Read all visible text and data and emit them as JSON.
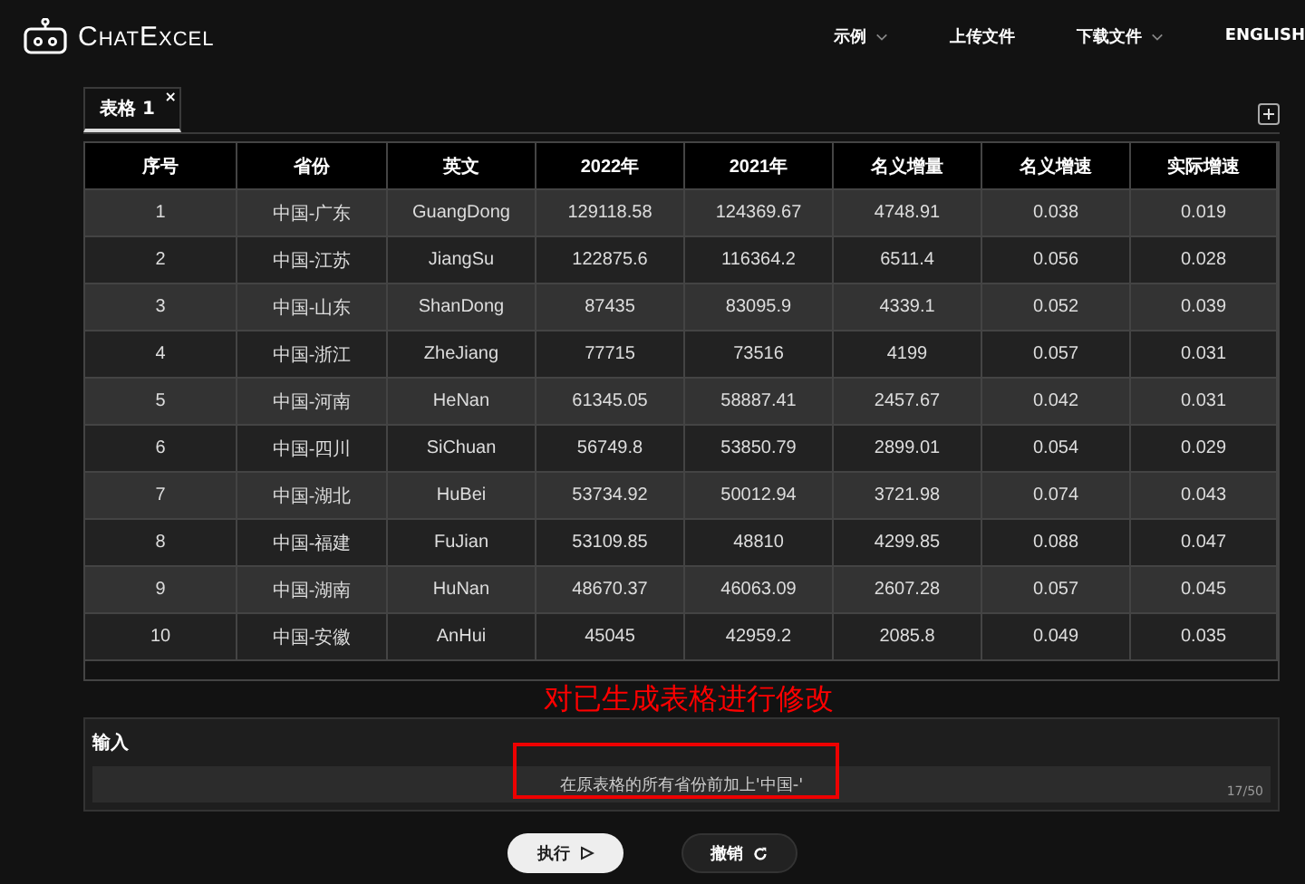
{
  "header": {
    "logo": "ChatExcel",
    "nav": [
      {
        "label": "示例",
        "dropdown": true
      },
      {
        "label": "上传文件",
        "dropdown": false
      },
      {
        "label": "下载文件",
        "dropdown": true
      },
      {
        "label": "ENGLISH",
        "dropdown": false
      }
    ]
  },
  "tabs": [
    {
      "label": "表格 1",
      "selected": true,
      "close": "×"
    }
  ],
  "table": {
    "columns": [
      "序号",
      "省份",
      "英文",
      "2022年",
      "2021年",
      "名义增量",
      "名义增速",
      "实际增速"
    ],
    "rows": [
      [
        "1",
        "中国-广东",
        "GuangDong",
        "129118.58",
        "124369.67",
        "4748.91",
        "0.038",
        "0.019"
      ],
      [
        "2",
        "中国-江苏",
        "JiangSu",
        "122875.6",
        "116364.2",
        "6511.4",
        "0.056",
        "0.028"
      ],
      [
        "3",
        "中国-山东",
        "ShanDong",
        "87435",
        "83095.9",
        "4339.1",
        "0.052",
        "0.039"
      ],
      [
        "4",
        "中国-浙江",
        "ZheJiang",
        "77715",
        "73516",
        "4199",
        "0.057",
        "0.031"
      ],
      [
        "5",
        "中国-河南",
        "HeNan",
        "61345.05",
        "58887.41",
        "2457.67",
        "0.042",
        "0.031"
      ],
      [
        "6",
        "中国-四川",
        "SiChuan",
        "56749.8",
        "53850.79",
        "2899.01",
        "0.054",
        "0.029"
      ],
      [
        "7",
        "中国-湖北",
        "HuBei",
        "53734.92",
        "50012.94",
        "3721.98",
        "0.074",
        "0.043"
      ],
      [
        "8",
        "中国-福建",
        "FuJian",
        "53109.85",
        "48810",
        "4299.85",
        "0.088",
        "0.047"
      ],
      [
        "9",
        "中国-湖南",
        "HuNan",
        "48670.37",
        "46063.09",
        "2607.28",
        "0.057",
        "0.045"
      ],
      [
        "10",
        "中国-安徽",
        "AnHui",
        "45045",
        "42959.2",
        "2085.8",
        "0.049",
        "0.035"
      ]
    ]
  },
  "annotation": "对已生成表格进行修改",
  "input": {
    "label": "输入",
    "value": "在原表格的所有省份前加上'中国-'",
    "counter": "17/50"
  },
  "buttons": [
    {
      "label": "执行",
      "kind": "run"
    },
    {
      "label": "撤销",
      "kind": "undo"
    }
  ]
}
